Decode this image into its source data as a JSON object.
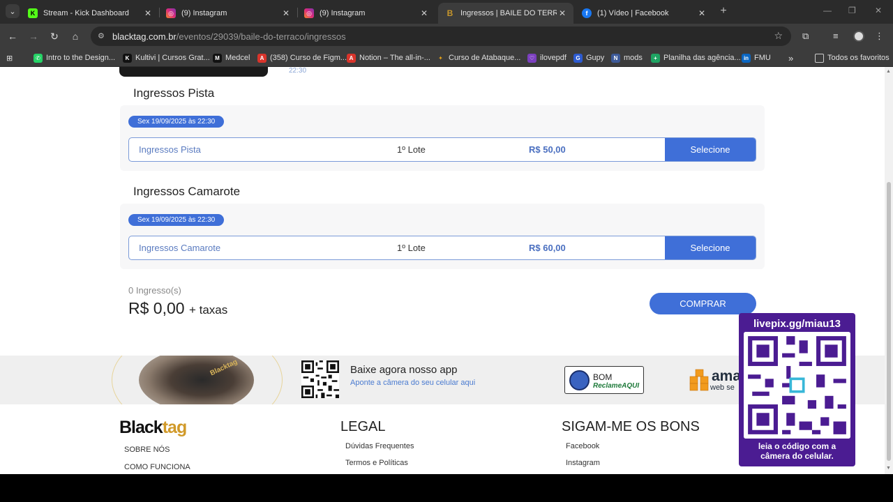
{
  "tabs": [
    {
      "title": "Stream - Kick Dashboard",
      "favicon": "kick-icon",
      "fav_letter": "K",
      "color": "#53fc18",
      "active": false
    },
    {
      "title": "(9) Instagram",
      "favicon": "instagram-icon",
      "fav_letter": "◎",
      "color": "#e1306c",
      "active": false
    },
    {
      "title": "(9) Instagram",
      "favicon": "instagram-icon",
      "fav_letter": "◎",
      "color": "#e1306c",
      "active": false
    },
    {
      "title": "Ingressos | BAILE DO TERRAÇO",
      "favicon": "blacktag-icon",
      "fav_letter": "B",
      "color": "#c7962c",
      "active": true
    },
    {
      "title": "(1) Vídeo | Facebook",
      "favicon": "facebook-icon",
      "fav_letter": "f",
      "color": "#1877f2",
      "active": false
    }
  ],
  "address": {
    "host": "blacktag.com.br",
    "path": "/eventos/29039/baile-do-terraco/ingressos"
  },
  "bookmarks": [
    {
      "label": "Intro to the Design...",
      "color": "#25d366",
      "letter": "✆"
    },
    {
      "label": "Kultivi | Cursos Grat...",
      "color": "#111111",
      "letter": "K"
    },
    {
      "label": "Medcel",
      "color": "#111111",
      "letter": "M"
    },
    {
      "label": "(358) Curso de Figm...",
      "color": "#d9342b",
      "letter": "A"
    },
    {
      "label": "Notion – The all-in-...",
      "color": "#d9342b",
      "letter": "A"
    },
    {
      "label": "Curso de Atabaque...",
      "color": "#e8a317",
      "letter": "✦"
    },
    {
      "label": "ilovepdf",
      "color": "#7b3fbf",
      "letter": "♡"
    },
    {
      "label": "Gupy",
      "color": "#2d5bd1",
      "letter": "G"
    },
    {
      "label": "mods",
      "color": "#3d5a99",
      "letter": "N"
    },
    {
      "label": "Planilha das agência...",
      "color": "#1fa463",
      "letter": "+"
    },
    {
      "label": "FMU",
      "color": "#0a66c2",
      "letter": "in"
    }
  ],
  "bookmarks_more": "»",
  "all_bookmarks": "Todos os favoritos",
  "event": {
    "time_fragment": "22:30"
  },
  "sections": [
    {
      "title": "Ingressos Pista",
      "date": "Sex 19/09/2025 às 22:30",
      "ticket_name": "Ingressos Pista",
      "lote": "1º Lote",
      "price": "R$ 50,00",
      "select_label": "Selecione"
    },
    {
      "title": "Ingressos Camarote",
      "date": "Sex 19/09/2025 às 22:30",
      "ticket_name": "Ingressos Camarote",
      "lote": "1º Lote",
      "price": "R$ 60,00",
      "select_label": "Selecione"
    }
  ],
  "summary": {
    "qty": "0 Ingresso(s)",
    "total": "R$ 0,00",
    "tax": "+ taxas",
    "buy_label": "COMPRAR"
  },
  "app_band": {
    "title": "Baixe agora nosso app",
    "subtitle": "Aponte a câmera do seu celular aqui",
    "phone_logo": "Blacktag",
    "reclame_bom": "BOM",
    "reclame_name": "ReclameAQUI",
    "aws_main": "ama",
    "aws_sub": "web se"
  },
  "footer": {
    "logo_black": "Black",
    "logo_tag": "tag",
    "about_links": [
      "SOBRE NÓS",
      "COMO FUNCIONA"
    ],
    "legal_title": "LEGAL",
    "legal_links": [
      "Dúvidas Frequentes",
      "Termos e Políticas"
    ],
    "social_title": "SIGAM-ME OS BONS",
    "social_links": [
      "Facebook",
      "Instagram"
    ]
  },
  "livepix": {
    "top": "livepix.gg/miau13",
    "bottom_line1": "leia o código com a",
    "bottom_line2": "câmera do celular."
  },
  "colors": {
    "accent": "#3f6fd8",
    "brand_gold": "#d19a2a",
    "livepix_purple": "#4b1c92"
  }
}
